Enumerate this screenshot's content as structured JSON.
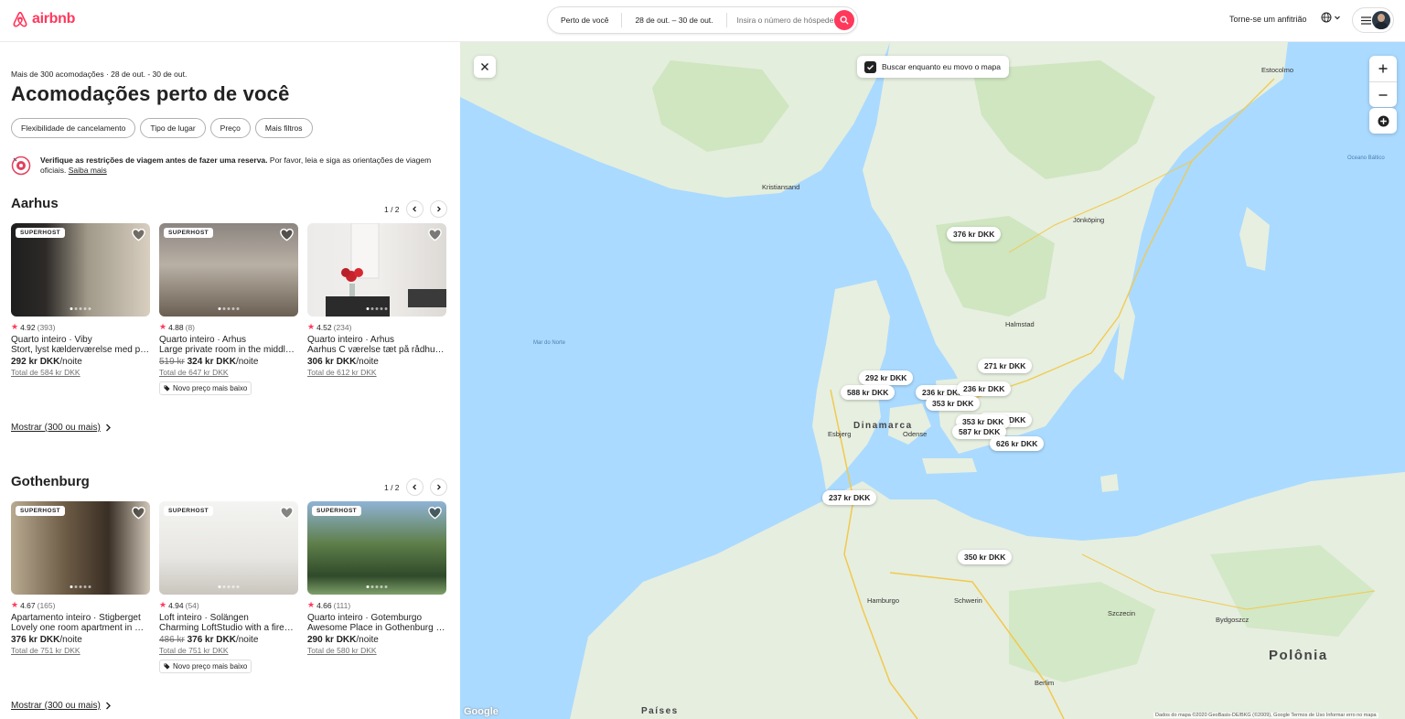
{
  "header": {
    "brand": "airbnb",
    "search_location": "Perto de você",
    "search_dates": "28 de out. – 30 de out.",
    "search_guests_placeholder": "Insira o número de hóspedes",
    "host_link": "Torne-se um anfitrião",
    "brand_color": "#ff385c"
  },
  "results": {
    "subhead": "Mais de 300 acomodações · 28 de out. - 30 de out.",
    "title": "Acomodações perto de você",
    "filters": [
      "Flexibilidade de cancelamento",
      "Tipo de lugar",
      "Preço",
      "Mais filtros"
    ],
    "alert": {
      "bold": "Verifique as restrições de viagem antes de fazer uma reserva.",
      "text": "Por favor, leia e siga as orientações de viagem oficiais.",
      "link": "Saiba mais"
    }
  },
  "sections": [
    {
      "title": "Aarhus",
      "pager": "1 / 2",
      "show_more": "Mostrar (300 ou mais)",
      "cards": [
        {
          "badge": "SUPERHOST",
          "rating": "4.92",
          "reviews": "(393)",
          "type": "Quarto inteiro · Viby",
          "desc": "Stort, lyst kælderværelse med privat indgang",
          "old_price": "",
          "price": "292 kr DKK",
          "per": "/noite",
          "total": "Total de 584 kr DKK",
          "tag": ""
        },
        {
          "badge": "SUPERHOST",
          "rating": "4.88",
          "reviews": "(8)",
          "type": "Quarto inteiro · Arhus",
          "desc": "Large private room in the middle of Aarhus",
          "old_price": "519 kr",
          "price": "324 kr DKK",
          "per": "/noite",
          "total": "Total de 647 kr DKK",
          "tag": "Novo preço mais baixo"
        },
        {
          "badge": "",
          "rating": "4.52",
          "reviews": "(234)",
          "type": "Quarto inteiro · Arhus",
          "desc": "Aarhus C værelse tæt på rådhuset",
          "old_price": "",
          "price": "306 kr DKK",
          "per": "/noite",
          "total": "Total de 612 kr DKK",
          "tag": ""
        }
      ]
    },
    {
      "title": "Gothenburg",
      "pager": "1 / 2",
      "show_more": "Mostrar (300 ou mais)",
      "cards": [
        {
          "badge": "SUPERHOST",
          "rating": "4.67",
          "reviews": "(165)",
          "type": "Apartamento inteiro · Stigberget",
          "desc": "Lovely one room apartment in Majorna",
          "old_price": "",
          "price": "376 kr DKK",
          "per": "/noite",
          "total": "Total de 751 kr DKK",
          "tag": ""
        },
        {
          "badge": "SUPERHOST",
          "rating": "4.94",
          "reviews": "(54)",
          "type": "Loft inteiro · Solängen",
          "desc": "Charming LoftStudio with a fireplace",
          "old_price": "486 kr",
          "price": "376 kr DKK",
          "per": "/noite",
          "total": "Total de 751 kr DKK",
          "tag": "Novo preço mais baixo"
        },
        {
          "badge": "SUPERHOST",
          "rating": "4.66",
          "reviews": "(111)",
          "type": "Quarto inteiro · Gotemburgo",
          "desc": "Awesome Place in Gothenburg City",
          "old_price": "",
          "price": "290 kr DKK",
          "per": "/noite",
          "total": "Total de 580 kr DKK",
          "tag": ""
        }
      ]
    }
  ],
  "map": {
    "search_as_move": "Buscar enquanto eu movo o mapa",
    "pins": [
      "376 kr DKK",
      "271 kr DKK",
      "292 kr DKK",
      "588 kr DKK",
      "236 kr DKK",
      "236 kr DKK",
      "353 kr DKK",
      "338 kr DKK",
      "353 kr DKK",
      "587 kr DKK",
      "626 kr DKK",
      "237 kr DKK",
      "350 kr DKK"
    ],
    "labels": {
      "sea_north": "Mar do Norte",
      "denmark": "Dinamarca",
      "poland": "Polônia",
      "netherlands": "Países",
      "stockholm": "Estocolmo",
      "baltic": "Oceano Báltico",
      "hamburg": "Hamburgo",
      "berlin": "Berlim",
      "kristiansand": "Kristiansand",
      "jonkoping": "Jönköping",
      "halmstad": "Halmstad",
      "odense": "Odense",
      "esbjerg": "Esbjerg",
      "schwerin": "Schwerin",
      "bydgoszcz": "Bydgoszcz",
      "szczecin": "Szczecin"
    },
    "google": "Google",
    "attribution": "Dados do mapa ©2020 GeoBasis-DE/BKG (©2009), Google   Termos de Uso   Informar erro no mapa",
    "colors": {
      "water": "#aadaff",
      "land": "#e8f0e3",
      "green": "#c5e3b5"
    }
  }
}
